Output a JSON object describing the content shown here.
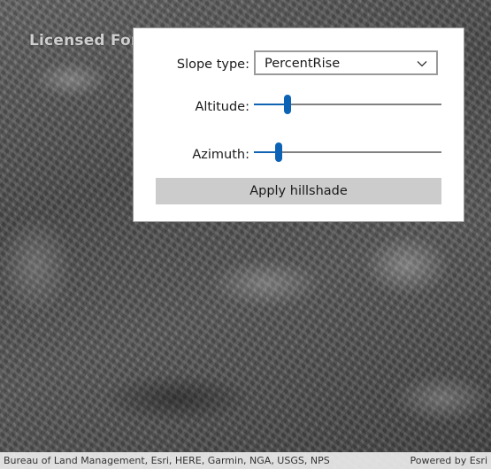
{
  "map": {
    "license_watermark": "Licensed For",
    "attribution": "Bureau of Land Management, Esri, HERE, Garmin, NGA, USGS, NPS",
    "powered_by": "Powered by Esri"
  },
  "panel": {
    "slope_type": {
      "label": "Slope type:",
      "selected": "PercentRise",
      "icon": "chevron-down-icon"
    },
    "altitude": {
      "label": "Altitude:",
      "value_fraction": 0.18
    },
    "azimuth": {
      "label": "Azimuth:",
      "value_fraction": 0.13
    },
    "apply_button": "Apply hillshade"
  },
  "colors": {
    "accent": "#0c63b5",
    "button_bg": "#cccccc",
    "panel_bg": "#ffffff"
  }
}
